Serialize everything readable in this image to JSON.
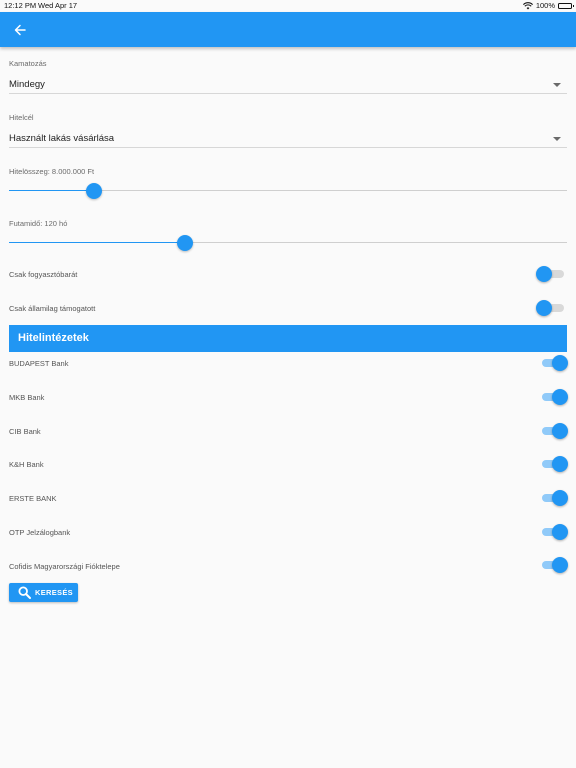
{
  "status_bar": {
    "time": "12:12 PM",
    "date": "Wed Apr 17",
    "battery": "100%",
    "icons": [
      "wifi-icon",
      "battery-icon"
    ]
  },
  "app_bar": {
    "back_icon": "arrow-left-icon",
    "color": "#2196f3"
  },
  "filters": {
    "interest": {
      "label": "Kamatozás",
      "value": "Mindegy"
    },
    "purpose": {
      "label": "Hitelcél",
      "value": "Használt lakás vásárlása"
    },
    "amount": {
      "label": "Hitelösszeg: 8.000.000 Ft",
      "fraction": 0.153
    },
    "term": {
      "label": "Futamidő: 120 hó",
      "fraction": 0.315
    },
    "consumer_friendly": {
      "label": "Csak fogyasztóbarát",
      "on": false
    },
    "state_supported": {
      "label": "Csak államilag támogatott",
      "on": false
    }
  },
  "institutions": {
    "title": "Hitelintézetek",
    "banks": [
      {
        "label": "BUDAPEST Bank",
        "on": true
      },
      {
        "label": "MKB Bank",
        "on": true
      },
      {
        "label": "CIB Bank",
        "on": true
      },
      {
        "label": "K&H Bank",
        "on": true
      },
      {
        "label": "ERSTE BANK",
        "on": true
      },
      {
        "label": "OTP Jelzálogbank",
        "on": true
      },
      {
        "label": "Cofidis Magyarországi Fióktelepe",
        "on": true
      }
    ]
  },
  "search_button": {
    "label": "KERESÉS",
    "icon": "search-icon"
  }
}
